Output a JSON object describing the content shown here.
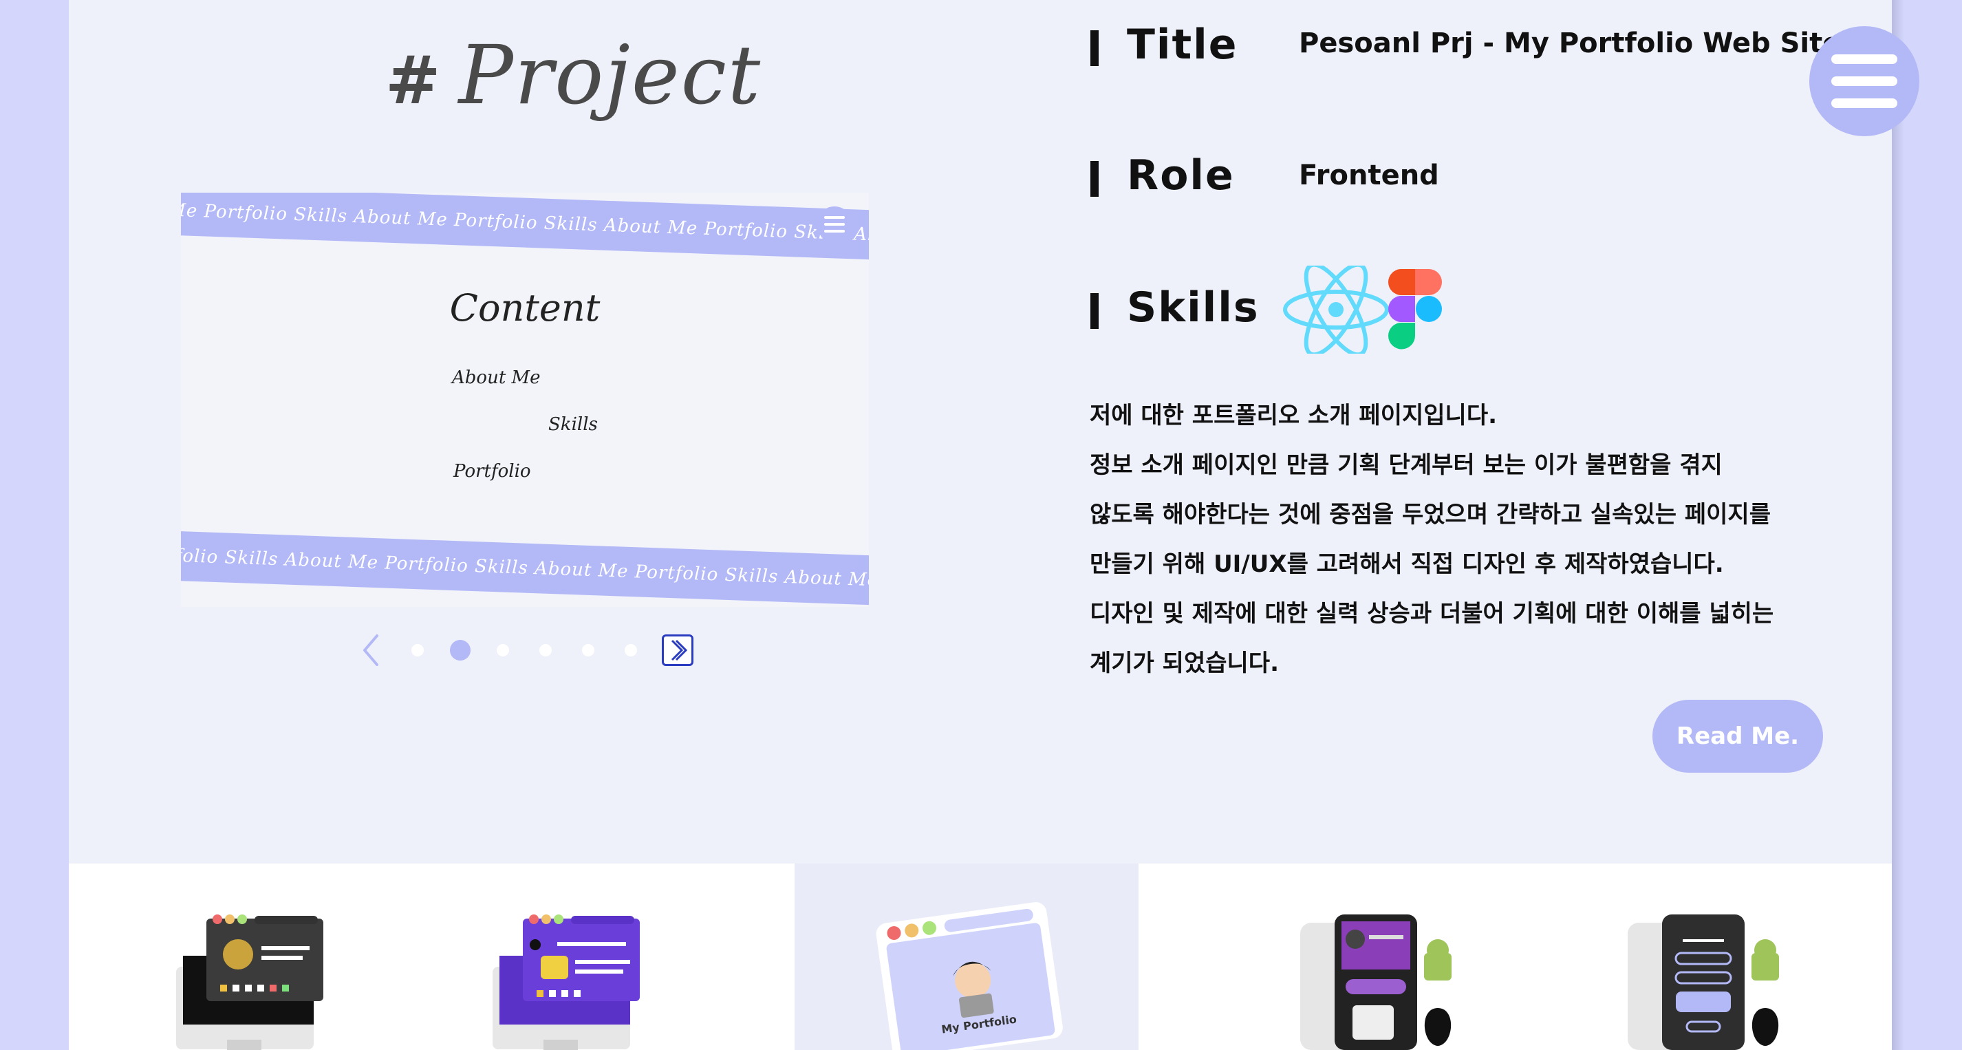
{
  "project": {
    "heading_hash": "#",
    "heading": "Project"
  },
  "preview": {
    "ribbon_top_text": "Me Portfolio Skills About Me Portfolio Skills About Me Portfolio Skills About Me Portfolio Skills About Me",
    "ribbon_bottom_text": "tfolio Skills About Me Portfolio Skills About Me Portfolio Skills About Me Portfolio Skills About Me Portfolio",
    "title": "Content",
    "links": [
      "About Me",
      "Skills",
      "Portfolio"
    ]
  },
  "carousel": {
    "dot_count": 6,
    "active_index": 1
  },
  "info": {
    "title_label": "Title",
    "title_value": "Pesoanl Prj - My Portfolio Web Site",
    "role_label": "Role",
    "role_value": "Frontend",
    "skills_label": "Skills",
    "skills_icons": [
      "react-icon",
      "figma-icon"
    ],
    "description_lines": [
      "저에 대한 포트폴리오 소개 페이지입니다.",
      "정보 소개 페이지인 만큼 기획 단계부터 보는 이가 불편함을 겪지",
      "않도록 해야한다는 것에 중점을 두었으며 간략하고 실속있는 페이지를",
      "만들기 위해 UI/UX를 고려해서 직접 디자인 후 제작하였습니다.",
      "디자인 및 제작에 대한 실력 상승과 더불어 기획에 대한 이해를 넓히는",
      "계기가 되었습니다."
    ],
    "read_me_label": "Read Me."
  },
  "thumbnails": {
    "portfolio_caption": "My Portfolio"
  },
  "colors": {
    "accent": "#b3b8f7",
    "background": "#d4d7fb",
    "panel": "#eef1f9",
    "text": "#111111"
  }
}
